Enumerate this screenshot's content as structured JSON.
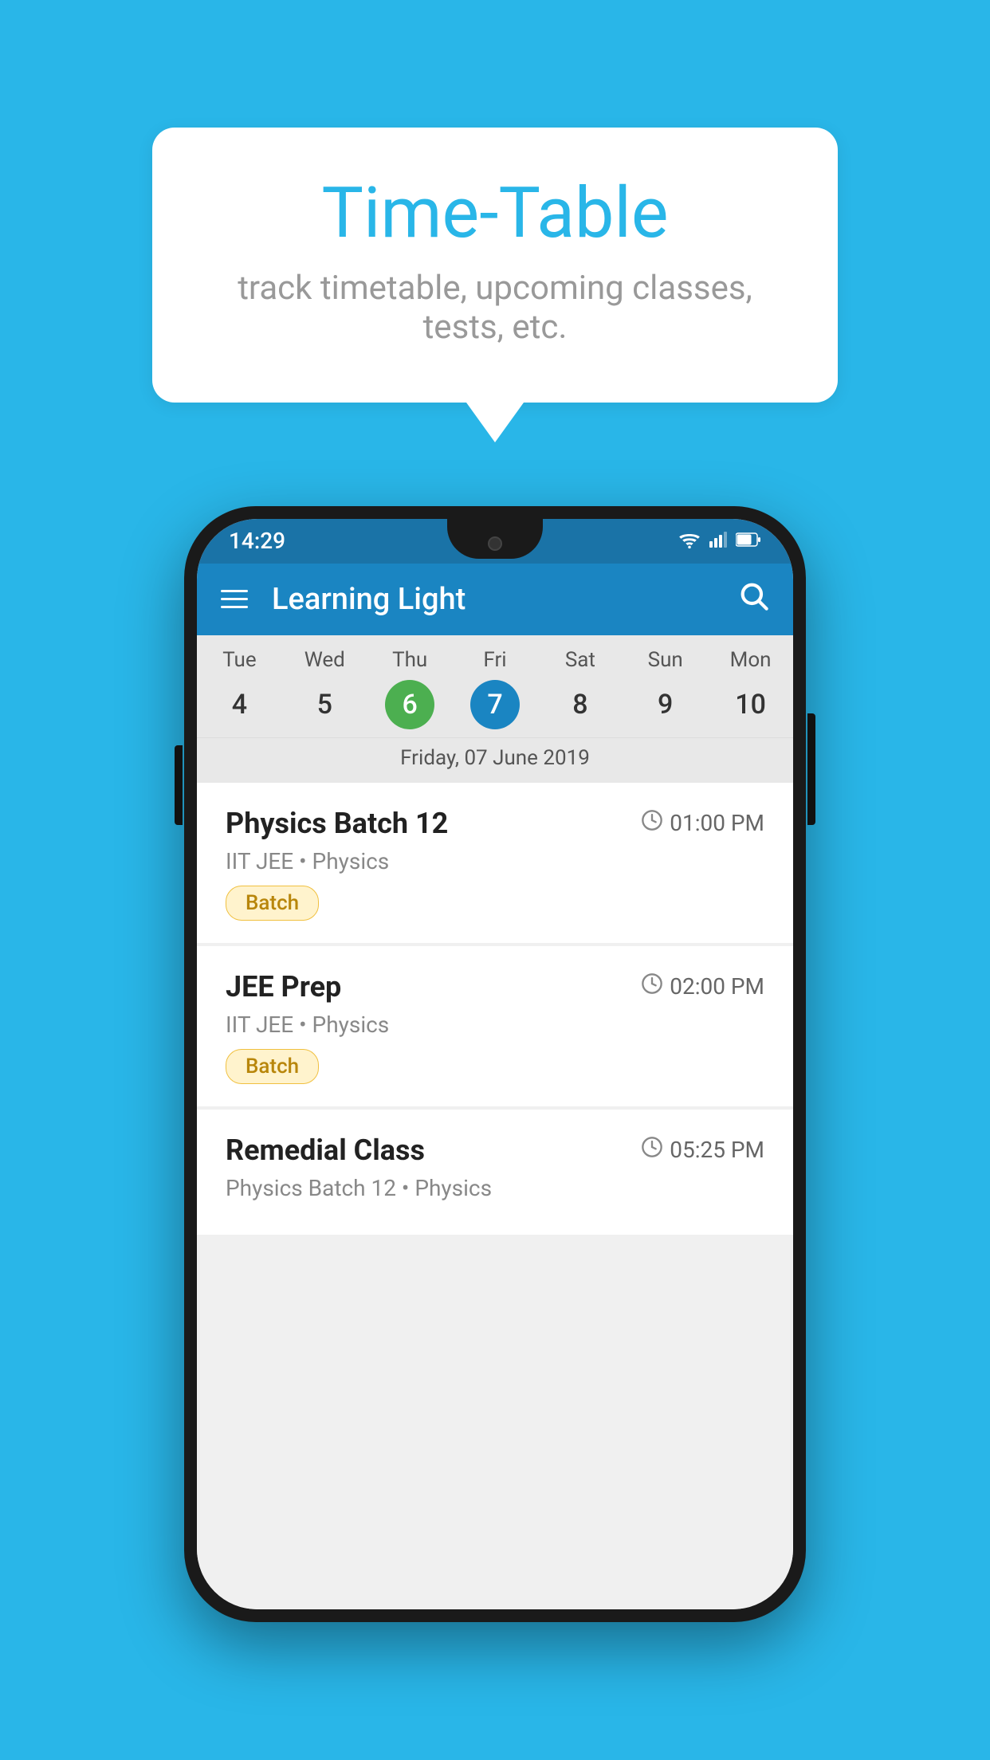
{
  "background_color": "#29b6e8",
  "speech_bubble": {
    "title": "Time-Table",
    "subtitle": "track timetable, upcoming classes, tests, etc."
  },
  "status_bar": {
    "time": "14:29",
    "wifi": "▼",
    "signal": "▲",
    "battery": "▮"
  },
  "app_bar": {
    "title": "Learning Light"
  },
  "calendar": {
    "days": [
      {
        "name": "Tue",
        "num": "4",
        "state": "normal"
      },
      {
        "name": "Wed",
        "num": "5",
        "state": "normal"
      },
      {
        "name": "Thu",
        "num": "6",
        "state": "today"
      },
      {
        "name": "Fri",
        "num": "7",
        "state": "selected"
      },
      {
        "name": "Sat",
        "num": "8",
        "state": "normal"
      },
      {
        "name": "Sun",
        "num": "9",
        "state": "normal"
      },
      {
        "name": "Mon",
        "num": "10",
        "state": "normal"
      }
    ],
    "selected_date_label": "Friday, 07 June 2019"
  },
  "schedule": [
    {
      "name": "Physics Batch 12",
      "time": "01:00 PM",
      "sub": "IIT JEE • Physics",
      "badge": "Batch"
    },
    {
      "name": "JEE Prep",
      "time": "02:00 PM",
      "sub": "IIT JEE • Physics",
      "badge": "Batch"
    },
    {
      "name": "Remedial Class",
      "time": "05:25 PM",
      "sub": "Physics Batch 12 • Physics",
      "badge": null
    }
  ]
}
